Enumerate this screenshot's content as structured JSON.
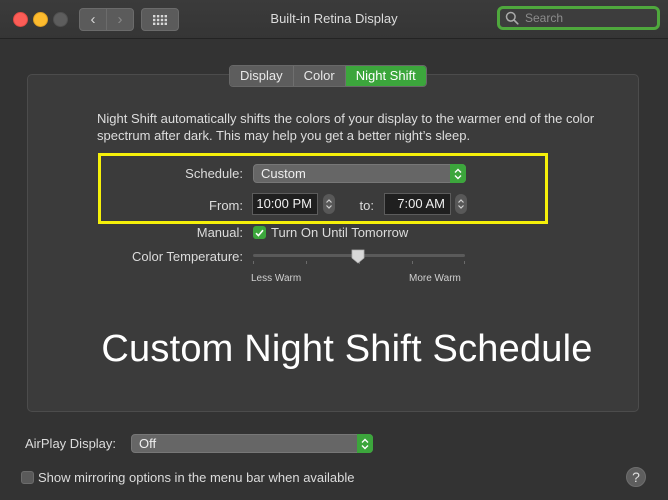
{
  "window": {
    "title": "Built-in Retina Display",
    "search_placeholder": "Search",
    "nav_back_glyph": "‹",
    "nav_forward_glyph": "›"
  },
  "tabs": [
    {
      "label": "Display",
      "active": false
    },
    {
      "label": "Color",
      "active": false
    },
    {
      "label": "Night Shift",
      "active": true
    }
  ],
  "night_shift": {
    "description": "Night Shift automatically shifts the colors of your display to the warmer end of the color spectrum after dark. This may help you get a better night’s sleep.",
    "schedule_label": "Schedule:",
    "schedule_value": "Custom",
    "from_label": "From:",
    "from_value": "10:00 PM",
    "to_label": "to:",
    "to_value": "7:00 AM",
    "manual_label": "Manual:",
    "manual_checkbox_label": "Turn On Until Tomorrow",
    "manual_checked": true,
    "color_temp_label": "Color Temperature:",
    "temp_min_label": "Less Warm",
    "temp_max_label": "More Warm",
    "temp_level": 0.5
  },
  "overlay_caption": "Custom Night Shift Schedule",
  "airplay": {
    "label": "AirPlay Display:",
    "value": "Off"
  },
  "mirroring": {
    "label": "Show mirroring options in the menu bar when available",
    "checked": false
  },
  "help_glyph": "?",
  "colors": {
    "accent_green": "#3ca63c",
    "highlight_yellow": "#f5f00a",
    "background": "#333333"
  }
}
